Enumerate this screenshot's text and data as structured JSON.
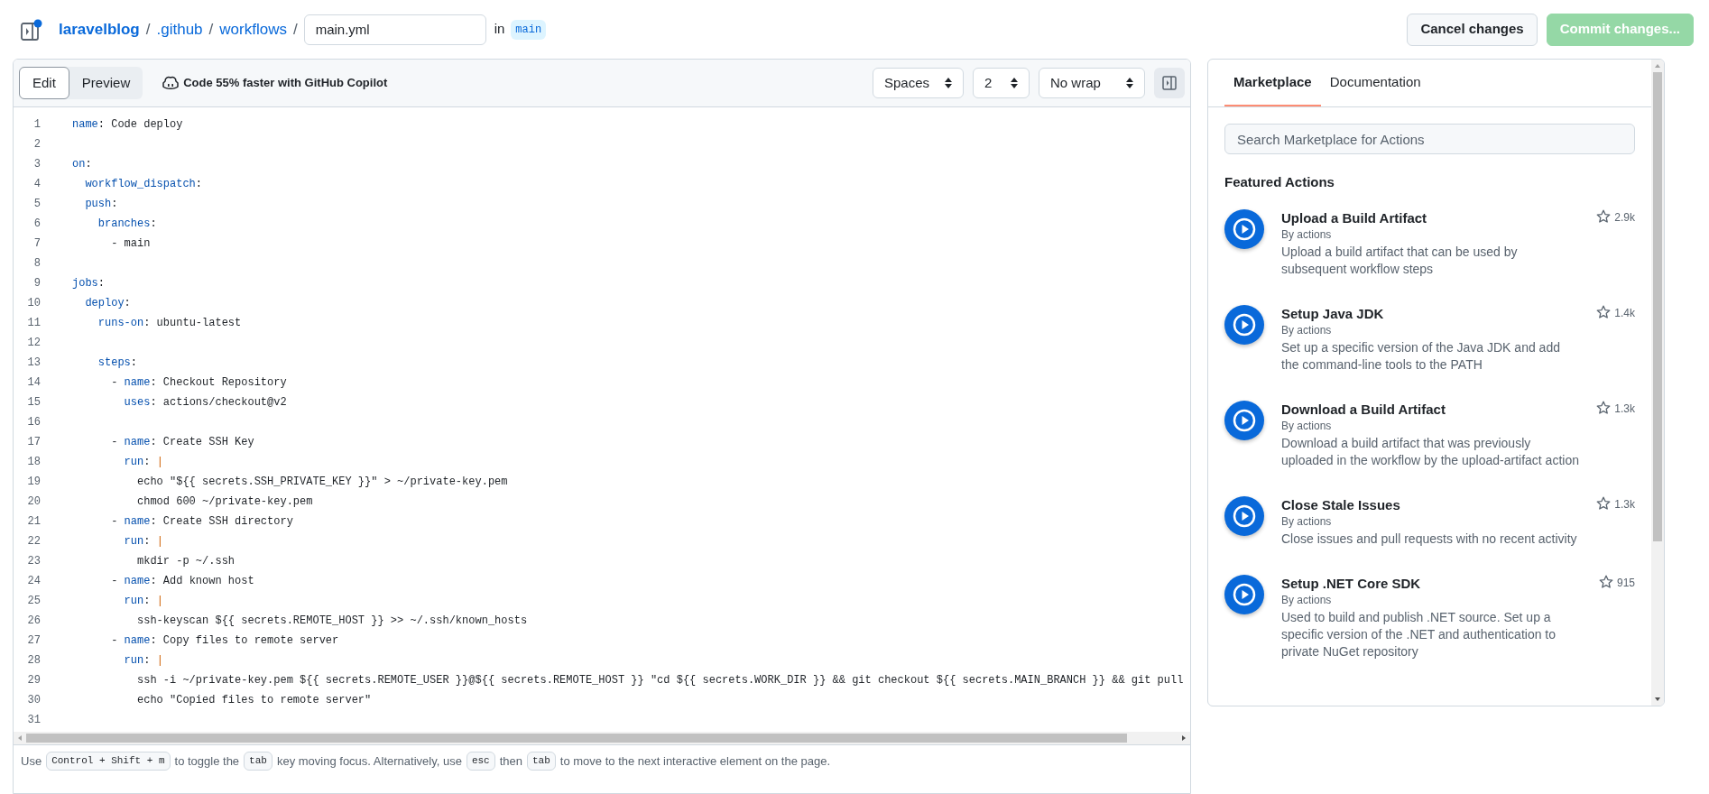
{
  "header": {
    "repo": "laravelblog",
    "path": [
      ".github",
      "workflows"
    ],
    "separator": "/",
    "filename": "main.yml",
    "in_label": "in",
    "branch": "main"
  },
  "actions_bar": [
    {
      "label": "Cancel changes",
      "kind": "default",
      "disabled": false
    },
    {
      "label": "Commit changes...",
      "kind": "primary",
      "disabled": true
    }
  ],
  "editor": {
    "tabs": [
      {
        "label": "Edit",
        "selected": true
      },
      {
        "label": "Preview",
        "selected": false
      }
    ],
    "copilot": "Code 55% faster with GitHub Copilot",
    "selects": [
      {
        "value": "Spaces"
      },
      {
        "value": "2"
      },
      {
        "value": "No wrap"
      }
    ],
    "lines": [
      {
        "number": "1",
        "tokens": [
          {
            "kind": "key",
            "text": "name"
          },
          {
            "kind": "plain",
            "text": ": Code deploy"
          }
        ]
      },
      {
        "number": "2"
      },
      {
        "number": "3",
        "tokens": [
          {
            "kind": "key",
            "text": "on"
          },
          {
            "kind": "plain",
            "text": ":"
          }
        ]
      },
      {
        "number": "4",
        "tokens": [
          {
            "kind": "key",
            "text": "  workflow_dispatch"
          },
          {
            "kind": "plain",
            "text": ":"
          }
        ]
      },
      {
        "number": "5",
        "tokens": [
          {
            "kind": "key",
            "text": "  push"
          },
          {
            "kind": "plain",
            "text": ":"
          }
        ]
      },
      {
        "number": "6",
        "tokens": [
          {
            "kind": "key",
            "text": "    branches"
          },
          {
            "kind": "plain",
            "text": ":"
          }
        ]
      },
      {
        "number": "7",
        "tokens": [
          {
            "kind": "plain",
            "text": "      - main"
          }
        ]
      },
      {
        "number": "8"
      },
      {
        "number": "9",
        "tokens": [
          {
            "kind": "key",
            "text": "jobs"
          },
          {
            "kind": "plain",
            "text": ":"
          }
        ]
      },
      {
        "number": "10",
        "tokens": [
          {
            "kind": "key",
            "text": "  deploy"
          },
          {
            "kind": "plain",
            "text": ":"
          }
        ]
      },
      {
        "number": "11",
        "tokens": [
          {
            "kind": "key",
            "text": "    runs-on"
          },
          {
            "kind": "plain",
            "text": ": ubuntu-latest"
          }
        ]
      },
      {
        "number": "12"
      },
      {
        "number": "13",
        "tokens": [
          {
            "kind": "key",
            "text": "    steps"
          },
          {
            "kind": "plain",
            "text": ":"
          }
        ]
      },
      {
        "number": "14",
        "tokens": [
          {
            "kind": "plain",
            "text": "      - "
          },
          {
            "kind": "key",
            "text": "name"
          },
          {
            "kind": "plain",
            "text": ": Checkout Repository"
          }
        ]
      },
      {
        "number": "15",
        "tokens": [
          {
            "kind": "key",
            "text": "        uses"
          },
          {
            "kind": "plain",
            "text": ": actions/checkout@v2"
          }
        ]
      },
      {
        "number": "16"
      },
      {
        "number": "17",
        "tokens": [
          {
            "kind": "plain",
            "text": "      - "
          },
          {
            "kind": "key",
            "text": "name"
          },
          {
            "kind": "plain",
            "text": ": Create SSH Key"
          }
        ]
      },
      {
        "number": "18",
        "tokens": [
          {
            "kind": "key",
            "text": "        run"
          },
          {
            "kind": "plain",
            "text": ": "
          },
          {
            "kind": "operator",
            "text": "|"
          }
        ]
      },
      {
        "number": "19",
        "tokens": [
          {
            "kind": "plain",
            "text": "          echo \"${{ secrets.SSH_PRIVATE_KEY }}\" > ~/private-key.pem"
          }
        ]
      },
      {
        "number": "20",
        "tokens": [
          {
            "kind": "plain",
            "text": "          chmod 600 ~/private-key.pem"
          }
        ]
      },
      {
        "number": "21",
        "tokens": [
          {
            "kind": "plain",
            "text": "      - "
          },
          {
            "kind": "key",
            "text": "name"
          },
          {
            "kind": "plain",
            "text": ": Create SSH directory"
          }
        ]
      },
      {
        "number": "22",
        "tokens": [
          {
            "kind": "key",
            "text": "        run"
          },
          {
            "kind": "plain",
            "text": ": "
          },
          {
            "kind": "operator",
            "text": "|"
          }
        ]
      },
      {
        "number": "23",
        "tokens": [
          {
            "kind": "plain",
            "text": "          mkdir -p ~/.ssh"
          }
        ]
      },
      {
        "number": "24",
        "tokens": [
          {
            "kind": "plain",
            "text": "      - "
          },
          {
            "kind": "key",
            "text": "name"
          },
          {
            "kind": "plain",
            "text": ": Add known host"
          }
        ]
      },
      {
        "number": "25",
        "tokens": [
          {
            "kind": "key",
            "text": "        run"
          },
          {
            "kind": "plain",
            "text": ": "
          },
          {
            "kind": "operator",
            "text": "|"
          }
        ]
      },
      {
        "number": "26",
        "tokens": [
          {
            "kind": "plain",
            "text": "          ssh-keyscan ${{ secrets.REMOTE_HOST }} >> ~/.ssh/known_hosts"
          }
        ]
      },
      {
        "number": "27",
        "tokens": [
          {
            "kind": "plain",
            "text": "      - "
          },
          {
            "kind": "key",
            "text": "name"
          },
          {
            "kind": "plain",
            "text": ": Copy files to remote server"
          }
        ]
      },
      {
        "number": "28",
        "tokens": [
          {
            "kind": "key",
            "text": "        run"
          },
          {
            "kind": "plain",
            "text": ": "
          },
          {
            "kind": "operator",
            "text": "|"
          }
        ]
      },
      {
        "number": "29",
        "tokens": [
          {
            "kind": "plain",
            "text": "          ssh -i ~/private-key.pem ${{ secrets.REMOTE_USER }}@${{ secrets.REMOTE_HOST }} \"cd ${{ secrets.WORK_DIR }} && git checkout ${{ secrets.MAIN_BRANCH }} && git pull"
          }
        ]
      },
      {
        "number": "30",
        "tokens": [
          {
            "kind": "plain",
            "text": "          echo \"Copied files to remote server\""
          }
        ]
      },
      {
        "number": "31"
      }
    ],
    "hint": [
      {
        "kind": "text",
        "text": "Use"
      },
      {
        "kind": "key",
        "text": "Control + Shift + m"
      },
      {
        "kind": "text",
        "text": "to toggle the"
      },
      {
        "kind": "key",
        "text": "tab"
      },
      {
        "kind": "text",
        "text": "key moving focus. Alternatively, use"
      },
      {
        "kind": "key",
        "text": "esc"
      },
      {
        "kind": "text",
        "text": "then"
      },
      {
        "kind": "key",
        "text": "tab"
      },
      {
        "kind": "text",
        "text": "to move to the next interactive element on the page."
      }
    ]
  },
  "panel": {
    "tabs": [
      {
        "label": "Marketplace",
        "selected": true
      },
      {
        "label": "Documentation",
        "selected": false
      }
    ],
    "search_placeholder": "Search Marketplace for Actions",
    "heading": "Featured Actions",
    "actions": [
      {
        "title": "Upload a Build Artifact",
        "author": "By actions",
        "description": "Upload a build artifact that can be used by subsequent workflow steps",
        "star_count": "2.9k"
      },
      {
        "title": "Setup Java JDK",
        "author": "By actions",
        "description": "Set up a specific version of the Java JDK and add the command-line tools to the PATH",
        "star_count": "1.4k"
      },
      {
        "title": "Download a Build Artifact",
        "author": "By actions",
        "description": "Download a build artifact that was previously uploaded in the workflow by the upload-artifact action",
        "star_count": "1.3k"
      },
      {
        "title": "Close Stale Issues",
        "author": "By actions",
        "description": "Close issues and pull requests with no recent activity",
        "star_count": "1.3k"
      },
      {
        "title": "Setup .NET Core SDK",
        "author": "By actions",
        "description": "Used to build and publish .NET source. Set up a specific version of the .NET and authentication to private NuGet repository",
        "star_count": "915"
      }
    ]
  }
}
